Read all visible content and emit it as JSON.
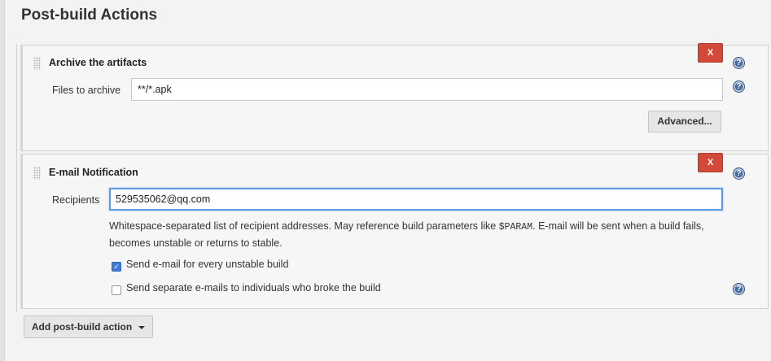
{
  "section": {
    "title": "Post-build Actions"
  },
  "archive": {
    "title": "Archive the artifacts",
    "delete_label": "X",
    "help_glyph": "?",
    "files_label": "Files to archive",
    "files_value": "**/*.apk",
    "advanced_label": "Advanced..."
  },
  "email": {
    "title": "E-mail Notification",
    "delete_label": "X",
    "help_glyph": "?",
    "recipients_label": "Recipients",
    "recipients_value": "529535062@qq.com",
    "help_text_before": "Whitespace-separated list of recipient addresses. May reference build parameters like ",
    "help_text_code": "$PARAM",
    "help_text_after": ". E-mail will be sent when a build fails, becomes unstable or returns to stable.",
    "checkbox_unstable_label": "Send e-mail for every unstable build",
    "checkbox_unstable_checked": true,
    "checkbox_individuals_label": "Send separate e-mails to individuals who broke the build",
    "checkbox_individuals_checked": false
  },
  "add_action": {
    "label": "Add post-build action"
  },
  "icons": {
    "help": "help-icon",
    "grip": "drag-handle-icon",
    "caret": "caret-down-icon",
    "check": "checkmark-icon"
  },
  "colors": {
    "delete_button": "#d24939",
    "help_icon": "#4a6d9e",
    "focus_border": "#5b9ce0",
    "checkbox_checked": "#3e7ad6"
  }
}
